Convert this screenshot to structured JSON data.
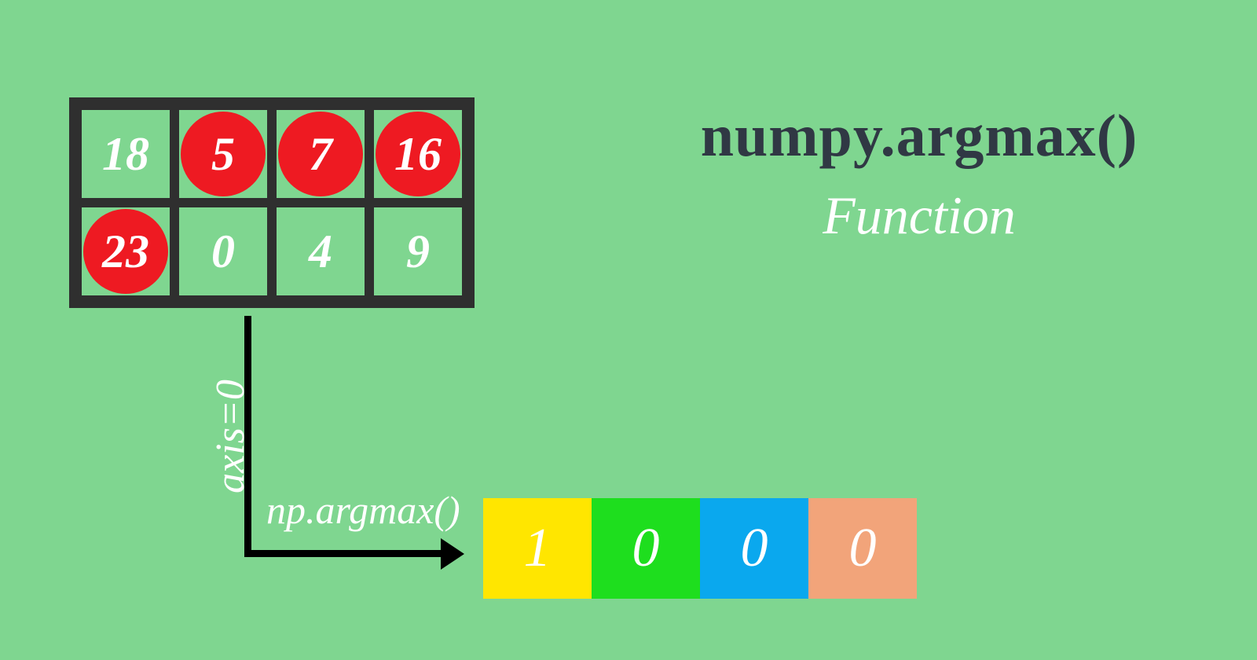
{
  "matrix": {
    "rows": [
      [
        {
          "v": "18",
          "hl": false
        },
        {
          "v": "5",
          "hl": true
        },
        {
          "v": "7",
          "hl": true
        },
        {
          "v": "16",
          "hl": true
        }
      ],
      [
        {
          "v": "23",
          "hl": true
        },
        {
          "v": "0",
          "hl": false
        },
        {
          "v": "4",
          "hl": false
        },
        {
          "v": "9",
          "hl": false
        }
      ]
    ]
  },
  "title": {
    "main": "numpy.argmax()",
    "sub": "Function"
  },
  "axis": {
    "label": "axis=0",
    "func": "np.argmax()"
  },
  "result": [
    {
      "v": "1",
      "color": "#ffe600"
    },
    {
      "v": "0",
      "color": "#1ede1e"
    },
    {
      "v": "0",
      "color": "#0aa8ee"
    },
    {
      "v": "0",
      "color": "#f2a47a"
    }
  ]
}
